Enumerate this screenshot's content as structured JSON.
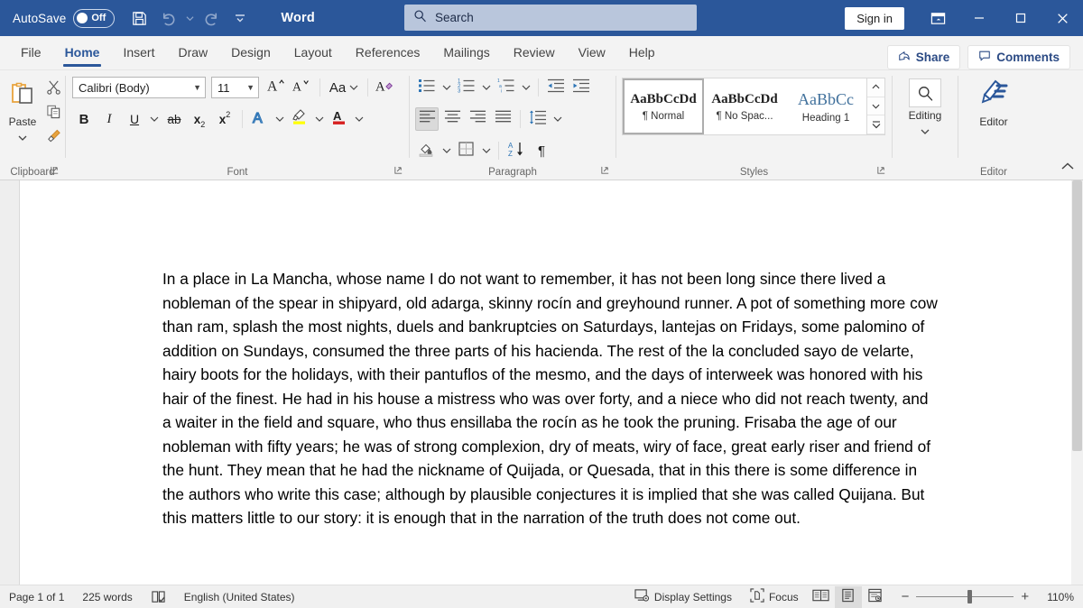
{
  "titlebar": {
    "autosave_label": "AutoSave",
    "autosave_state": "Off",
    "save_icon": "save-icon",
    "undo_icon": "undo-icon",
    "redo_icon": "redo-icon",
    "customize_icon": "customize-quick-access-toolbar-icon",
    "app_title": "Word",
    "search_placeholder": "Search",
    "search_value": "",
    "search_icon": "search-icon",
    "signin_label": "Sign in",
    "ribbon_display_icon": "ribbon-display-options-icon",
    "minimize_icon": "minimize-icon",
    "maximize_icon": "maximize-icon",
    "close_icon": "close-icon",
    "bg_color": "#2b579a"
  },
  "tabs": [
    {
      "label": "File",
      "active": false
    },
    {
      "label": "Home",
      "active": true
    },
    {
      "label": "Insert",
      "active": false
    },
    {
      "label": "Draw",
      "active": false
    },
    {
      "label": "Design",
      "active": false
    },
    {
      "label": "Layout",
      "active": false
    },
    {
      "label": "References",
      "active": false
    },
    {
      "label": "Mailings",
      "active": false
    },
    {
      "label": "Review",
      "active": false
    },
    {
      "label": "View",
      "active": false
    },
    {
      "label": "Help",
      "active": false
    }
  ],
  "tabbar_actions": {
    "share_label": "Share",
    "share_icon": "share-icon",
    "comments_label": "Comments",
    "comments_icon": "comment-icon",
    "accent_color": "#2b579a"
  },
  "ribbon": {
    "clipboard": {
      "group_label": "Clipboard",
      "paste_label": "Paste",
      "paste_icon": "paste-icon",
      "cut_icon": "scissors-cut-icon",
      "copy_icon": "copy-icon",
      "format_painter_icon": "format-painter-icon",
      "dialog_launcher_icon": "dialog-launcher-icon"
    },
    "font": {
      "group_label": "Font",
      "font_name": "Calibri (Body)",
      "font_size": "11",
      "grow_font_icon": "grow-font-icon",
      "shrink_font_icon": "shrink-font-icon",
      "change_case_label": "Aa",
      "change_case_icon": "change-case-icon",
      "clear_formatting_icon": "clear-formatting-icon",
      "bold_label": "B",
      "italic_label": "I",
      "underline_label": "U",
      "strikethrough_label": "ab",
      "subscript_label": "x",
      "subscript_sub": "2",
      "superscript_label": "x",
      "superscript_sup": "2",
      "text_effects_icon": "text-effects-icon",
      "highlight_icon": "text-highlight-color-icon",
      "highlight_color": "#ffff00",
      "font_color_icon": "font-color-icon",
      "font_color": "#d62020",
      "dialog_launcher_icon": "dialog-launcher-icon"
    },
    "paragraph": {
      "group_label": "Paragraph",
      "bullets_icon": "bullets-icon",
      "numbering_icon": "numbering-icon",
      "multilevel_icon": "multilevel-list-icon",
      "decrease_indent_icon": "decrease-indent-icon",
      "increase_indent_icon": "increase-indent-icon",
      "align_left_icon": "align-left-icon",
      "align_center_icon": "align-center-icon",
      "align_right_icon": "align-right-icon",
      "justify_icon": "justify-icon",
      "line_spacing_icon": "line-spacing-icon",
      "shading_icon": "shading-icon",
      "borders_icon": "borders-icon",
      "sort_icon": "sort-icon",
      "show_marks_icon": "show-formatting-marks-icon",
      "show_marks_label": "¶",
      "dialog_launcher_icon": "dialog-launcher-icon"
    },
    "styles": {
      "group_label": "Styles",
      "items": [
        {
          "sample": "AaBbCcDd",
          "name": "¶ Normal",
          "selected": true,
          "heading": false
        },
        {
          "sample": "AaBbCcDd",
          "name": "¶ No Spac...",
          "selected": false,
          "heading": false
        },
        {
          "sample": "AaBbCc",
          "name": "Heading 1",
          "selected": false,
          "heading": true
        }
      ],
      "scroll_up_icon": "chevron-up-icon",
      "scroll_down_icon": "chevron-down-icon",
      "more_icon": "styles-more-icon",
      "dialog_launcher_icon": "dialog-launcher-icon"
    },
    "editing": {
      "group_label": "",
      "label": "Editing",
      "icon": "search-icon",
      "dropdown_icon": "chevron-down-icon"
    },
    "editor": {
      "group_label": "Editor",
      "label": "Editor",
      "icon": "editor-pen-icon"
    },
    "collapse_icon": "collapse-ribbon-icon"
  },
  "document": {
    "paragraph": "In a place in La Mancha, whose name I do not want to remember, it has not been long since there lived a nobleman of the spear in shipyard, old adarga, skinny rocín and greyhound runner. A pot of something more cow than ram, splash the most nights, duels and bankruptcies on Saturdays, lantejas on Fridays, some palomino of addition on Sundays, consumed the three parts of his hacienda. The rest of the la concluded sayo de velarte, hairy boots for the holidays, with their pantuflos of the mesmo, and the days of interweek was honored with his hair of the finest. He had in his house a mistress who was over forty, and a niece who did not reach twenty, and a waiter in the field and square, who thus ensillaba the rocín as he took the pruning. Frisaba the age of our nobleman with fifty years; he was of strong complexion, dry of meats, wiry of face, great early riser and friend of the hunt. They mean that he had the nickname of Quijada, or Quesada, that in this there is some difference in the authors who write this case; although by plausible conjectures it is implied that she was called Quijana. But this matters little to our story: it is enough that in the narration of the truth does not come out."
  },
  "statusbar": {
    "page_label": "Page 1 of 1",
    "word_count": "225 words",
    "proofing_icon": "proofing-errors-icon",
    "language": "English (United States)",
    "display_settings_label": "Display Settings",
    "display_settings_icon": "display-settings-icon",
    "focus_label": "Focus",
    "focus_icon": "focus-mode-icon",
    "read_mode_icon": "read-mode-icon",
    "print_layout_icon": "print-layout-icon",
    "web_layout_icon": "web-layout-icon",
    "zoom_out_label": "−",
    "zoom_in_label": "+",
    "zoom_level": "110%"
  }
}
